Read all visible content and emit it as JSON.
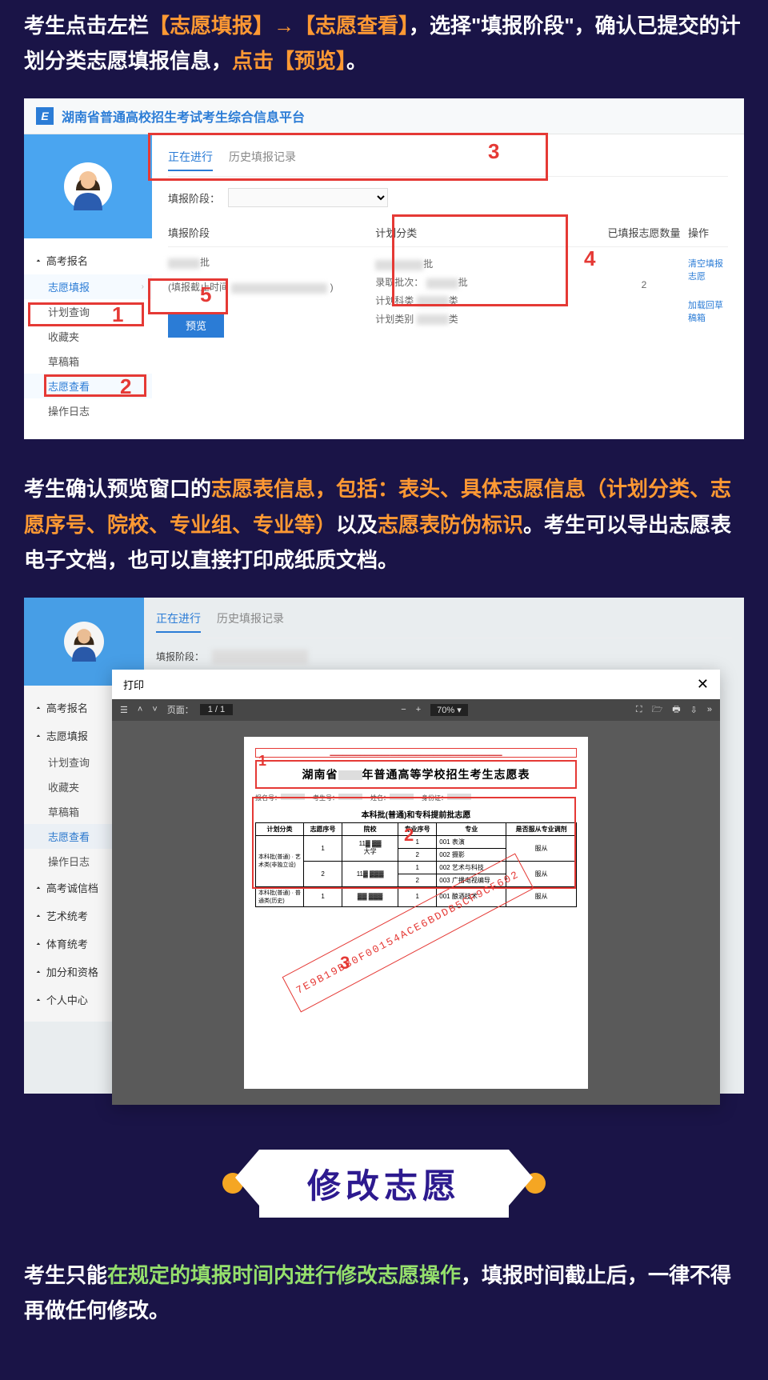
{
  "intro1": {
    "p1": "考生点击左栏",
    "h1": "【志愿填报】→【志愿查看】",
    "p2": "，选择\"填报阶段\"，确认已提交的计划分类志愿填报信息，",
    "h2": "点击【预览】",
    "p3": "。"
  },
  "shot1": {
    "header": "湖南省普通高校招生考试考生综合信息平台",
    "nav_gaokao": "高考报名",
    "nav_zytb": "志愿填报",
    "nav_jhcx": "计划查询",
    "nav_scj": "收藏夹",
    "nav_cgx": "草稿箱",
    "nav_zyck": "志愿查看",
    "nav_czrz": "操作日志",
    "tab_active": "正在进行",
    "tab_history": "历史填报记录",
    "filter_label": "填报阶段：",
    "col_phase": "填报阶段",
    "col_plan": "计划分类",
    "col_count": "已填报志愿数量",
    "col_ops": "操作",
    "row_batch_suffix": "批",
    "row_deadline": "(填报截止时间",
    "row_lqpc": "录取批次：",
    "row_lqpc_suffix": "批",
    "row_jhkl": "计划科类",
    "row_jhkl_suffix": "类",
    "row_jhlb": "计划类别",
    "row_jhlb_suffix": "类",
    "count_val": "2",
    "link_clear": "清空填报志愿",
    "link_load": "加载回草稿箱",
    "preview_btn": "预览",
    "marks": {
      "n1": "1",
      "n2": "2",
      "n3": "3",
      "n4": "4",
      "n5": "5"
    }
  },
  "intro2": {
    "p1": "考生确认预览窗口的",
    "h1": "志愿表信息，包括：表头、具体志愿信息（计划分类、志愿序号、院校、专业组、专业等）",
    "p2": "以及",
    "h2": "志愿表防伪标识",
    "p3": "。考生可以导出志愿表电子文档，也可以直接打印成纸质文档。"
  },
  "shot2": {
    "tab_active": "正在进行",
    "tab_history": "历史填报记录",
    "filter_label": "填报阶段：",
    "nav_gaokao": "高考报名",
    "nav_zytb": "志愿填报",
    "nav_jhcx": "计划查询",
    "nav_scj": "收藏夹",
    "nav_cgx": "草稿箱",
    "nav_zyck": "志愿查看",
    "nav_czrz": "操作日志",
    "nav_extra1": "高考诚信档",
    "nav_extra2": "艺术统考",
    "nav_extra3": "体育统考",
    "nav_extra4": "加分和资格",
    "nav_extra5": "个人中心",
    "modal_title": "打印",
    "toolbar_page_lbl": "页面：",
    "toolbar_page": "1 / 1",
    "toolbar_zoom": "70%",
    "doc_title_pre": "湖南省",
    "doc_title_post": "年普通高等学校招生考生志愿表",
    "doc_sub": "本科批(普通)和专科提前批志愿",
    "th_jhfl": "计划分类",
    "th_zyxh": "志愿序号",
    "th_yx": "院校",
    "th_zyzxh": "专业序号",
    "th_zy": "专业",
    "th_fc": "是否服从专业调剂",
    "row1_plan": "本科批(普通) · 艺术类(非独立设)",
    "row1_idx": "1",
    "row1_school": "大学",
    "row1_m1_idx": "1",
    "row1_m1": "001 表演",
    "row1_fc": "服从",
    "row1_m2_idx": "2",
    "row1_m2": "002 摄影",
    "row2_idx": "2",
    "row2_m1_idx": "1",
    "row2_m1": "002 艺术与科技",
    "row2_fc": "服从",
    "row2_m2_idx": "2",
    "row2_m2": "003 广播电视编导",
    "row3_plan": "本科批(普通) · 普通类(历史)",
    "row3_idx": "1",
    "row3_m1_idx": "1",
    "row3_m1": "001 酿酒技术",
    "row3_fc": "服从",
    "watermark": "7E9B19BB0F00154ACE6BDDB5CF9CF602",
    "marks": {
      "n1": "1",
      "n2": "2",
      "n3": "3"
    }
  },
  "banner": "修改志愿",
  "intro3": {
    "p1": "考生只能",
    "h1": "在规定的填报时间内进行修改志愿操作",
    "p2": "，填报时间截止后，一律不得再做任何修改。"
  }
}
